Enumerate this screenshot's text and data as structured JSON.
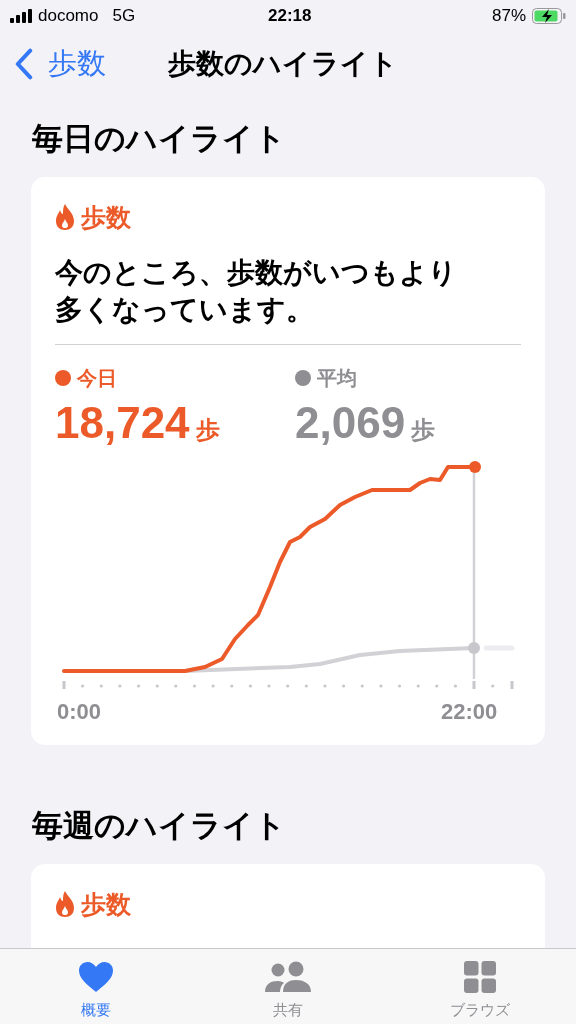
{
  "status_bar": {
    "carrier": "docomo",
    "network": "5G",
    "time": "22:18",
    "battery": "87%"
  },
  "nav": {
    "back": "歩数",
    "title": "歩数のハイライト"
  },
  "sections": [
    {
      "heading": "毎日のハイライト",
      "card": {
        "category": "歩数",
        "message": "今のところ、歩数がいつもより多くなっています。",
        "legend": [
          {
            "label": "今日",
            "value": "18,724",
            "unit": "歩",
            "color": "#eb5a28"
          },
          {
            "label": "平均",
            "value": "2,069",
            "unit": "歩",
            "color": "#8e8e93"
          }
        ],
        "x_labels": [
          "0:00",
          "22:00"
        ]
      }
    },
    {
      "heading": "毎週のハイライト",
      "card": {
        "category": "歩数"
      }
    }
  ],
  "tab_bar": [
    {
      "label": "概要",
      "selected": true
    },
    {
      "label": "共有",
      "selected": false
    },
    {
      "label": "ブラウズ",
      "selected": false
    }
  ]
}
